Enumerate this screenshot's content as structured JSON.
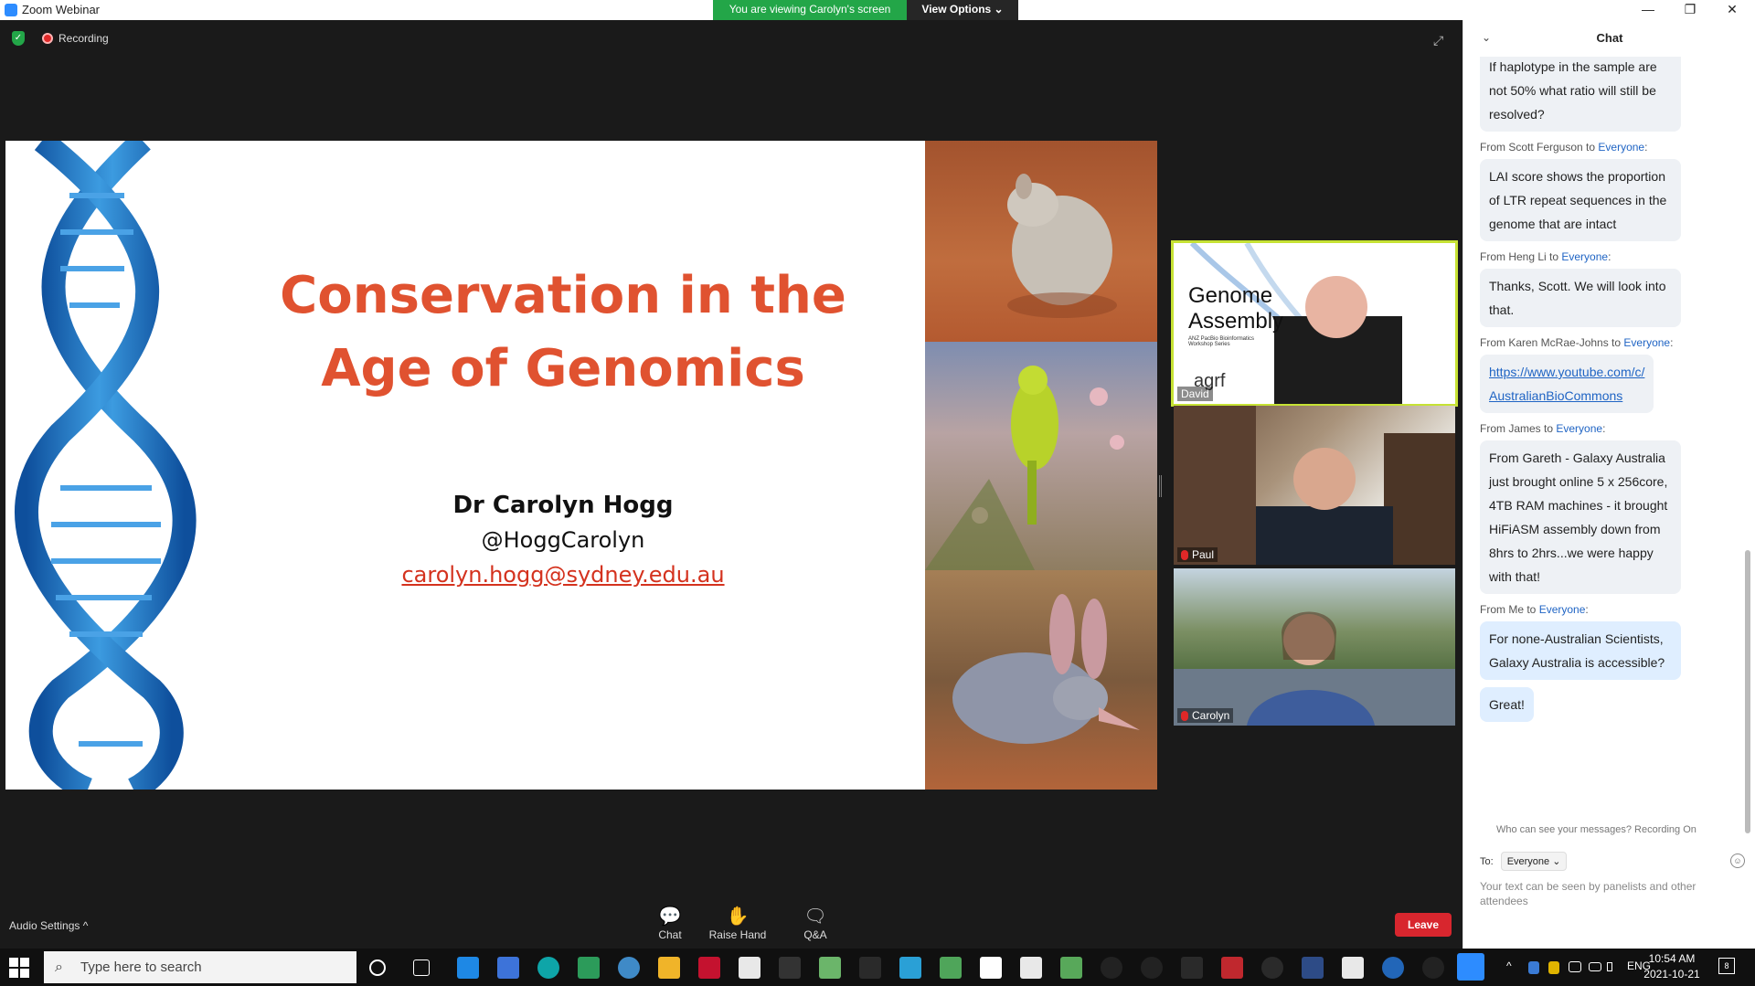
{
  "window": {
    "title": "Zoom Webinar",
    "banner_text": "You are viewing Carolyn's screen",
    "view_options": "View Options ⌄",
    "minimize": "—",
    "restore": "❐",
    "close": "✕"
  },
  "meeting": {
    "recording_label": "Recording"
  },
  "slide": {
    "title_line1": "Conservation in the",
    "title_line2": "Age of Genomics",
    "presenter_name": "Dr Carolyn Hogg",
    "presenter_handle": "@HoggCarolyn",
    "presenter_email": "carolyn.hogg@sydney.edu.au"
  },
  "videos": [
    {
      "name": "David",
      "slide_text1": "Genome",
      "slide_text2": "Assembly",
      "slide_sub": "ANZ PacBio Bioinformatics Workshop Series",
      "slide_logo": "agrf"
    },
    {
      "name": "Paul"
    },
    {
      "name": "Carolyn"
    }
  ],
  "toolbar": {
    "audio_settings": "Audio Settings ^",
    "chat": "Chat",
    "raise_hand": "Raise Hand",
    "qa": "Q&A",
    "leave": "Leave"
  },
  "chat": {
    "header": "Chat",
    "messages": [
      {
        "from": "",
        "to": "",
        "text": "If haplotype in the sample are not 50% what ratio will still be resolved?"
      },
      {
        "from": "From Scott Ferguson to ",
        "to": "Everyone",
        "text": "LAI score shows the proportion of LTR repeat sequences in the genome that are intact"
      },
      {
        "from": "From Heng Li to ",
        "to": "Everyone",
        "text": "Thanks, Scott. We will look into that."
      },
      {
        "from": "From Karen McRae-Johns to ",
        "to": "Everyone",
        "link1": "https://www.youtube.com/c/",
        "link2": "AustralianBioCommons"
      },
      {
        "from": "From James to ",
        "to": "Everyone",
        "text": "From Gareth - Galaxy Australia just brought online 5 x 256core, 4TB RAM machines - it brought HiFiASM assembly down from 8hrs to 2hrs...we were happy with that!"
      },
      {
        "from": "From Me to ",
        "to": "Everyone",
        "text": "For none-Australian Scientists, Galaxy Australia is accessible?",
        "text2": "Great!"
      }
    ],
    "who_can_see": "Who can see your messages? Recording On",
    "to_label": "To:",
    "to_value": "Everyone ⌄",
    "input_placeholder": "Your text can be seen by panelists and other attendees"
  },
  "taskbar": {
    "search_placeholder": "Type here to search",
    "language": "ENG",
    "time": "10:54 AM",
    "date": "2021-10-21",
    "notifications": "8"
  }
}
